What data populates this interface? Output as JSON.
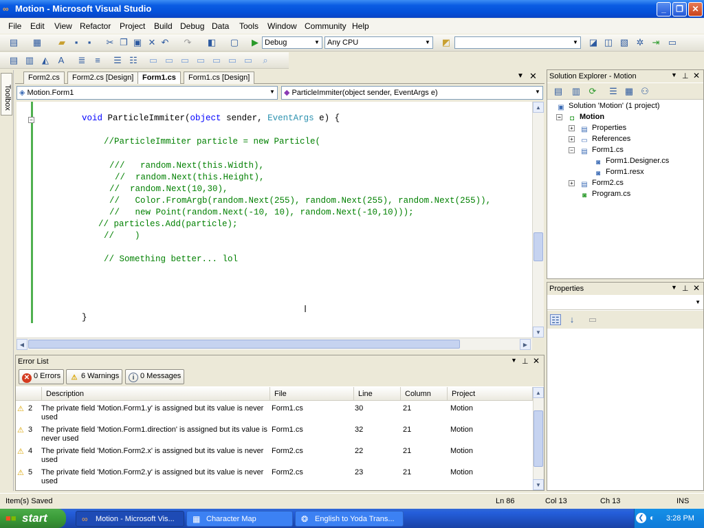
{
  "window": {
    "title": "Motion - Microsoft Visual Studio",
    "minimize_glyph": "_",
    "restore_glyph": "❐",
    "close_glyph": "✕"
  },
  "menu": [
    "File",
    "Edit",
    "View",
    "Refactor",
    "Project",
    "Build",
    "Debug",
    "Data",
    "Tools",
    "Window",
    "Community",
    "Help"
  ],
  "toolbar": {
    "configuration": "Debug",
    "platform": "Any CPU",
    "find_value": ""
  },
  "toolbox_label": "Toolbox",
  "document_tabs": [
    {
      "label": "Form2.cs"
    },
    {
      "label": "Form2.cs [Design]"
    },
    {
      "label": "Form1.cs",
      "active": true
    },
    {
      "label": "Form1.cs [Design]"
    }
  ],
  "navigation": {
    "class_combo": "Motion.Form1",
    "member_combo": "ParticleImmiter(object sender, EventArgs e)"
  },
  "code": {
    "l1": {
      "a": "void",
      "b": " ParticleImmiter(",
      "c": "object",
      "d": " sender, ",
      "e": "EventArgs",
      "f": " e) {"
    },
    "l2": "//ParticleImmiter particle = new Particle(",
    "l3": "///   random.Next(this.Width),",
    "l4": "//  random.Next(this.Height),",
    "l5": "//  random.Next(10,30),",
    "l6": "//   Color.FromArgb(random.Next(255), random.Next(255), random.Next(255)),",
    "l7": "//   new Point(random.Next(-10, 10), random.Next(-10,10)));",
    "l8": "// particles.Add(particle);",
    "l9": "//    )",
    "l10": "// Something better... lol",
    "l11": "}"
  },
  "solution_explorer": {
    "title": "Solution Explorer - Motion",
    "items": [
      {
        "label": "Solution 'Motion' (1 project)"
      },
      {
        "label": "Motion"
      },
      {
        "label": "Properties"
      },
      {
        "label": "References"
      },
      {
        "label": "Form1.cs"
      },
      {
        "label": "Form1.Designer.cs"
      },
      {
        "label": "Form1.resx"
      },
      {
        "label": "Form2.cs"
      },
      {
        "label": "Program.cs"
      }
    ]
  },
  "properties_panel": {
    "title": "Properties"
  },
  "error_list": {
    "title": "Error List",
    "filters": {
      "errors": "0 Errors",
      "warnings": "6 Warnings",
      "messages": "0 Messages"
    },
    "columns": [
      "Description",
      "File",
      "Line",
      "Column",
      "Project"
    ],
    "rows": [
      {
        "num": "2",
        "desc1": "The private field 'Motion.Form1.y' is assigned but its value is never",
        "desc2": "used",
        "file": "Form1.cs",
        "line": "30",
        "column": "21",
        "project": "Motion"
      },
      {
        "num": "3",
        "desc1": "The private field 'Motion.Form1.direction' is assigned but its value is",
        "desc2": "never used",
        "file": "Form1.cs",
        "line": "32",
        "column": "21",
        "project": "Motion"
      },
      {
        "num": "4",
        "desc1": "The private field 'Motion.Form2.x' is assigned but its value is never",
        "desc2": "used",
        "file": "Form2.cs",
        "line": "22",
        "column": "21",
        "project": "Motion"
      },
      {
        "num": "5",
        "desc1": "The private field 'Motion.Form2.y' is assigned but its value is never",
        "desc2": "used",
        "file": "Form2.cs",
        "line": "23",
        "column": "21",
        "project": "Motion"
      }
    ]
  },
  "status": {
    "message": "Item(s) Saved",
    "ln": "Ln 86",
    "col": "Col 13",
    "ch": "Ch 13",
    "mode": "INS"
  },
  "taskbar": {
    "start": "start",
    "tasks": [
      {
        "label": "Motion - Microsoft Vis..."
      },
      {
        "label": "Character Map"
      },
      {
        "label": "English to Yoda Trans..."
      }
    ],
    "clock": "3:28 PM"
  },
  "colors": {
    "code_comment": "#008000",
    "code_keyword": "#0000ff",
    "code_type": "#2b91af",
    "title_bar": "#0a5ce3",
    "taskbar": "#245edb",
    "start_button": "#3a9b38"
  }
}
